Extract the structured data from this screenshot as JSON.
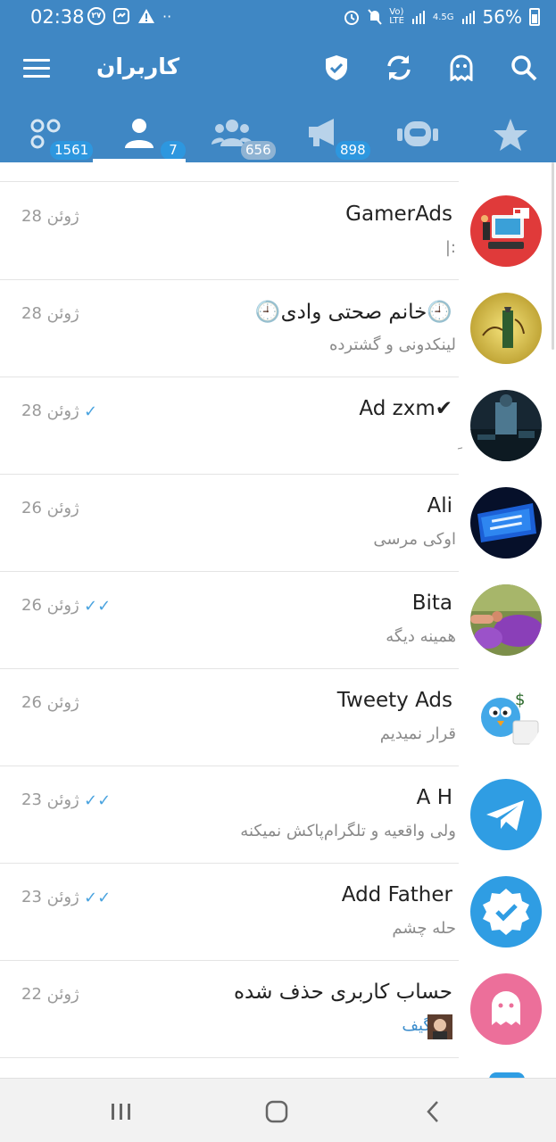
{
  "status_bar": {
    "time": "02:38",
    "badge_text": "۲۷",
    "dots": "··",
    "network": "4.5G",
    "battery": "56%"
  },
  "app_bar": {
    "title": "کاربران",
    "actions": [
      "shield-check-icon",
      "sync-icon",
      "ghost-icon",
      "search-icon"
    ]
  },
  "tabs": [
    {
      "icon": "all-chats-icon",
      "count": "1561",
      "active": false
    },
    {
      "icon": "user-icon",
      "count": "7",
      "active": true
    },
    {
      "icon": "group-icon",
      "count": "656",
      "active": false
    },
    {
      "icon": "channel-icon",
      "count": "898",
      "active": false
    },
    {
      "icon": "bot-icon",
      "count": "",
      "active": false
    },
    {
      "icon": "star-icon",
      "count": "",
      "active": false
    }
  ],
  "chats": [
    {
      "name": "GamerAds",
      "preview": ":|",
      "date": "28 ژوئن",
      "ticks": "",
      "avatar": "gamerads"
    },
    {
      "name": "🕘خانم صحتی وادی🕘",
      "preview": "لینکدونی و گشترده",
      "date": "28 ژوئن",
      "ticks": "",
      "avatar": "calligraphy"
    },
    {
      "name": "Ad zxm✔",
      "preview": "ِ",
      "date": "28 ژوئن",
      "ticks": "✓",
      "avatar": "dark-photo"
    },
    {
      "name": "Ali",
      "preview": "اوکی مرسی",
      "date": "26 ژوئن",
      "ticks": "",
      "avatar": "name-sign"
    },
    {
      "name": "Bita",
      "preview": "همینه دیگه",
      "date": "26 ژوئن",
      "ticks": "✓✓",
      "avatar": "flowers"
    },
    {
      "name": "Tweety Ads",
      "preview": "قرار نمیدیم",
      "date": "26 ژوئن",
      "ticks": "",
      "avatar": "bird"
    },
    {
      "name": "A H",
      "preview": "ولی واقعیه و تلگرام‌پاکش نمیکنه",
      "date": "23 ژوئن",
      "ticks": "✓✓",
      "avatar": "telegram"
    },
    {
      "name": "Add Father",
      "preview": "حله چشم",
      "date": "23 ژوئن",
      "ticks": "✓✓",
      "avatar": "verified"
    },
    {
      "name": "حساب کاربری حذف شده",
      "preview": "گیف",
      "date": "22 ژوئن",
      "ticks": "",
      "avatar": "ghost"
    }
  ],
  "colors": {
    "header": "#3f87c4",
    "badge_blue": "#2d97df",
    "badge_grey": "#8fb3d3",
    "tick": "#4aa3df"
  },
  "nav": [
    "recent-apps-icon",
    "home-icon",
    "back-icon"
  ]
}
